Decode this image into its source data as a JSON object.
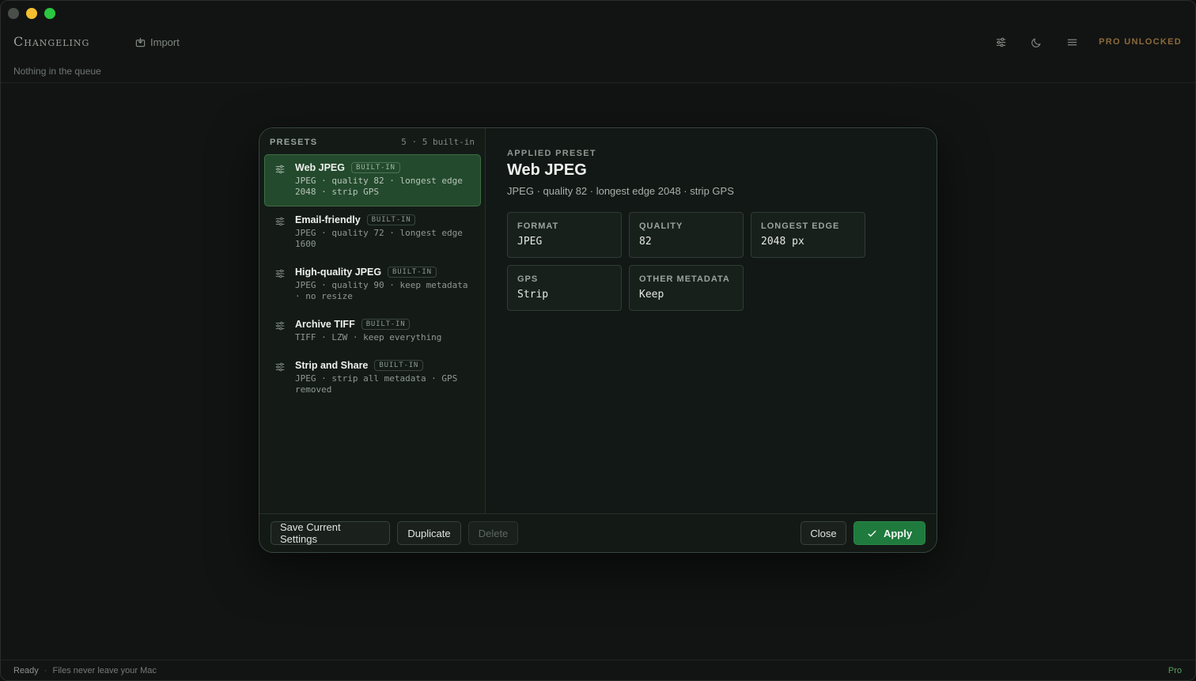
{
  "app": {
    "title": "Changeling",
    "import_label": "Import",
    "pro_status": "PRO UNLOCKED",
    "queue_status": "Nothing in the queue"
  },
  "footer": {
    "ready": "Ready",
    "separator": "·",
    "privacy": "Files never leave your Mac",
    "plan": "Pro"
  },
  "presets": {
    "title": "PRESETS",
    "count": "5 · 5 built-in",
    "items": [
      {
        "name": "Web JPEG",
        "badge": "BUILT-IN",
        "desc": "JPEG · quality 82 · longest edge 2048 · strip GPS",
        "selected": true
      },
      {
        "name": "Email-friendly",
        "badge": "BUILT-IN",
        "desc": "JPEG · quality 72 · longest edge 1600",
        "selected": false
      },
      {
        "name": "High-quality JPEG",
        "badge": "BUILT-IN",
        "desc": "JPEG · quality 90 · keep metadata · no resize",
        "selected": false
      },
      {
        "name": "Archive TIFF",
        "badge": "BUILT-IN",
        "desc": "TIFF · LZW · keep everything",
        "selected": false
      },
      {
        "name": "Strip and Share",
        "badge": "BUILT-IN",
        "desc": "JPEG · strip all metadata · GPS removed",
        "selected": false
      }
    ]
  },
  "detail": {
    "kicker": "APPLIED PRESET",
    "title": "Web JPEG",
    "desc": "JPEG · quality 82 · longest edge 2048 · strip GPS",
    "cards": [
      {
        "label": "FORMAT",
        "value": "JPEG"
      },
      {
        "label": "QUALITY",
        "value": "82"
      },
      {
        "label": "LONGEST EDGE",
        "value": "2048 px"
      },
      {
        "label": "GPS",
        "value": "Strip"
      },
      {
        "label": "OTHER METADATA",
        "value": "Keep"
      }
    ]
  },
  "actions": {
    "save": "Save Current Settings",
    "duplicate": "Duplicate",
    "delete": "Delete",
    "close": "Close",
    "apply": "Apply"
  },
  "colors": {
    "accent": "#1f7a3d",
    "selected_bg": "#234a2c",
    "pro": "#8c6a3a"
  }
}
